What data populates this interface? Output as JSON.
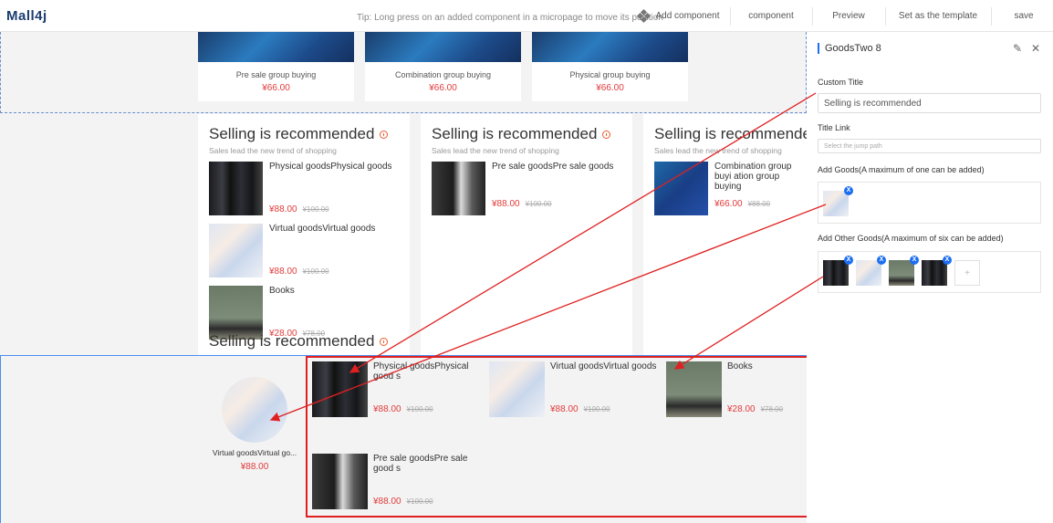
{
  "topbar": {
    "logo": "Mall4j",
    "tip": "Tip: Long press on an added component in a micropage to move its position",
    "add_component": "Add component",
    "component": "component",
    "preview": "Preview",
    "set_template": "Set as the template",
    "save": "save"
  },
  "top_cards": [
    {
      "name": "Pre sale group buying",
      "price": "¥66.00"
    },
    {
      "name": "Combination group buying",
      "price": "¥66.00"
    },
    {
      "name": "Physical group buying",
      "price": "¥66.00"
    }
  ],
  "rec_cards": [
    {
      "title": "Selling is recommended",
      "subtitle": "Sales lead the new trend of shopping",
      "goods": [
        {
          "name": "Physical goodsPhysical goods",
          "price": "¥88.00",
          "old": "¥100.00"
        },
        {
          "name": "Virtual goodsVirtual goods",
          "price": "¥88.00",
          "old": "¥100.00"
        },
        {
          "name": "Books",
          "price": "¥28.00",
          "old": "¥78.00"
        }
      ]
    },
    {
      "title": "Selling is recommended",
      "subtitle": "Sales lead the new trend of shopping",
      "goods": [
        {
          "name": "Pre sale goodsPre sale goods",
          "price": "¥88.00",
          "old": "¥100.00"
        }
      ]
    },
    {
      "title": "Selling is recommended",
      "subtitle": "Sales lead the new trend of shopping",
      "goods": [
        {
          "name": "Combination group buyi ation group buying",
          "price": "¥66.00",
          "old": "¥88.00"
        }
      ]
    }
  ],
  "bottom": {
    "title": "Selling is recommended",
    "main_good": {
      "name": "Virtual goodsVirtual go...",
      "price": "¥88.00"
    },
    "other_goods": [
      {
        "name": "Physical goodsPhysical good s",
        "price": "¥88.00",
        "old": "¥100.00"
      },
      {
        "name": "Virtual goodsVirtual goods",
        "price": "¥88.00",
        "old": "¥100.00"
      },
      {
        "name": "Books",
        "price": "¥28.00",
        "old": "¥78.00"
      },
      {
        "name": "Pre sale goodsPre sale good s",
        "price": "¥88.00",
        "old": "¥100.00"
      }
    ]
  },
  "panel": {
    "title": "GoodsTwo 8",
    "custom_title_label": "Custom Title",
    "custom_title_value": "Selling is recommended",
    "title_link_label": "Title Link",
    "title_link_placeholder": "Select the jump path",
    "add_goods_label": "Add Goods(A maximum of one can be added)",
    "add_other_label": "Add Other Goods(A maximum of six can be added)",
    "x": "X",
    "plus": "+"
  },
  "colors": {
    "accent": "#1c6ef2",
    "price": "#e23b3b",
    "annotation": "#e02020"
  }
}
